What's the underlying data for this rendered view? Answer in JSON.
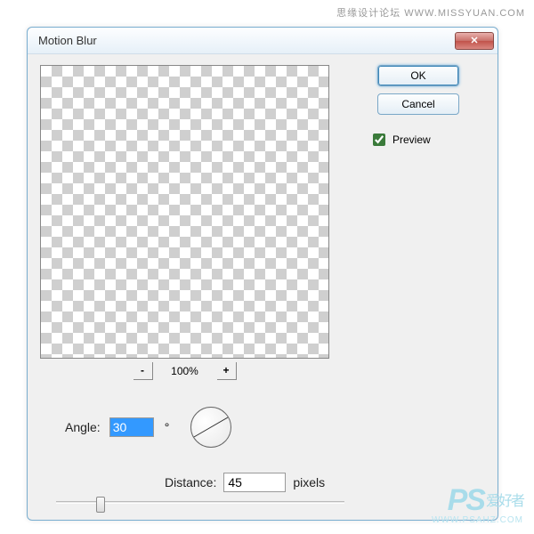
{
  "watermark_top": "思缘设计论坛 WWW.MISSYUAN.COM",
  "dialog": {
    "title": "Motion Blur",
    "close_symbol": "✕",
    "ok_label": "OK",
    "cancel_label": "Cancel",
    "preview_label": "Preview",
    "preview_checked": true,
    "zoom": {
      "minus": "-",
      "plus": "+",
      "level": "100%"
    },
    "angle": {
      "label": "Angle:",
      "value": "30",
      "degree": "°"
    },
    "distance": {
      "label": "Distance:",
      "value": "45",
      "unit": "pixels"
    }
  },
  "watermark_bottom": {
    "logo": "PS",
    "sub": "爱好者",
    "url": "WWW.PSAHZ.COM"
  }
}
